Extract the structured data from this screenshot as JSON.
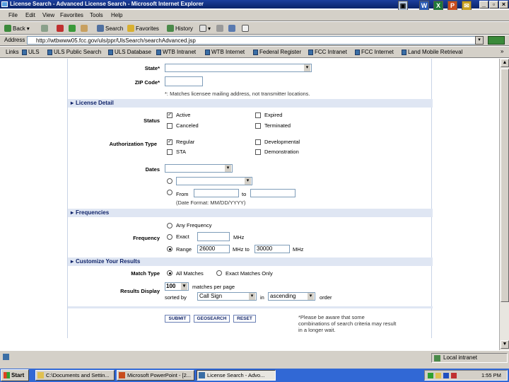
{
  "window": {
    "title": "License Search - Advanced License Search - Microsoft Internet Explorer"
  },
  "menu": [
    "File",
    "Edit",
    "View",
    "Favorites",
    "Tools",
    "Help"
  ],
  "toolbar": {
    "back": "Back",
    "search": "Search",
    "favorites": "Favorites",
    "history": "History"
  },
  "address": {
    "label": "Address",
    "url": "http://wtbwww05.fcc.gov/uls/ppr/UlsSearch/searchAdvanced.jsp"
  },
  "links": {
    "label": "Links",
    "items": [
      "ULS",
      "ULS Public Search",
      "ULS Database",
      "WTB Intranet",
      "WTB Internet",
      "Federal Register",
      "FCC Intranet",
      "FCC Internet",
      "Land Mobile Retrieval"
    ]
  },
  "form": {
    "state_label": "State*",
    "zip_label": "ZIP Code*",
    "address_note": "*: Matches licensee mailing address, not transmitter locations.",
    "license_detail": "License Detail",
    "status_label": "Status",
    "status_options": [
      "Active",
      "Canceled",
      "Expired",
      "Terminated"
    ],
    "auth_label": "Authorization Type",
    "auth_options": [
      "Regular",
      "STA",
      "Developmental",
      "Demonstration"
    ],
    "dates_label": "Dates",
    "from_label": "From",
    "to_label": "to",
    "date_format": "(Date Format: MM/DD/YYYY)",
    "frequencies": "Frequencies",
    "frequency_label": "Frequency",
    "any_frequency": "Any Frequency",
    "exact": "Exact",
    "mhz": "MHz",
    "range": "Range",
    "range_from": "26000",
    "range_to_label": "MHz to",
    "range_to": "30000",
    "customize": "Customize Your Results",
    "match_label": "Match Type",
    "all_matches": "All Matches",
    "exact_matches": "Exact Matches Only",
    "results_label": "Results Display",
    "per_page_value": "100",
    "per_page_text": "matches per page",
    "sorted_by": "sorted by",
    "sort_value": "Call Sign",
    "in_text": "in",
    "order_value": "ascending",
    "order_text": "order",
    "btn_submit": "SUBMIT",
    "btn_geosearch": "GEOSEARCH",
    "btn_reset": "RESET",
    "notice": "*Please be aware that some combinations of search criteria may result in a longer wait."
  },
  "status": {
    "zone": "Local intranet"
  },
  "taskbar": {
    "start": "Start",
    "tasks": [
      "C:\\Documents and Settin...",
      "Microsoft PowerPoint - [2...",
      "License Search - Advo..."
    ],
    "clock": "1:55 PM"
  }
}
